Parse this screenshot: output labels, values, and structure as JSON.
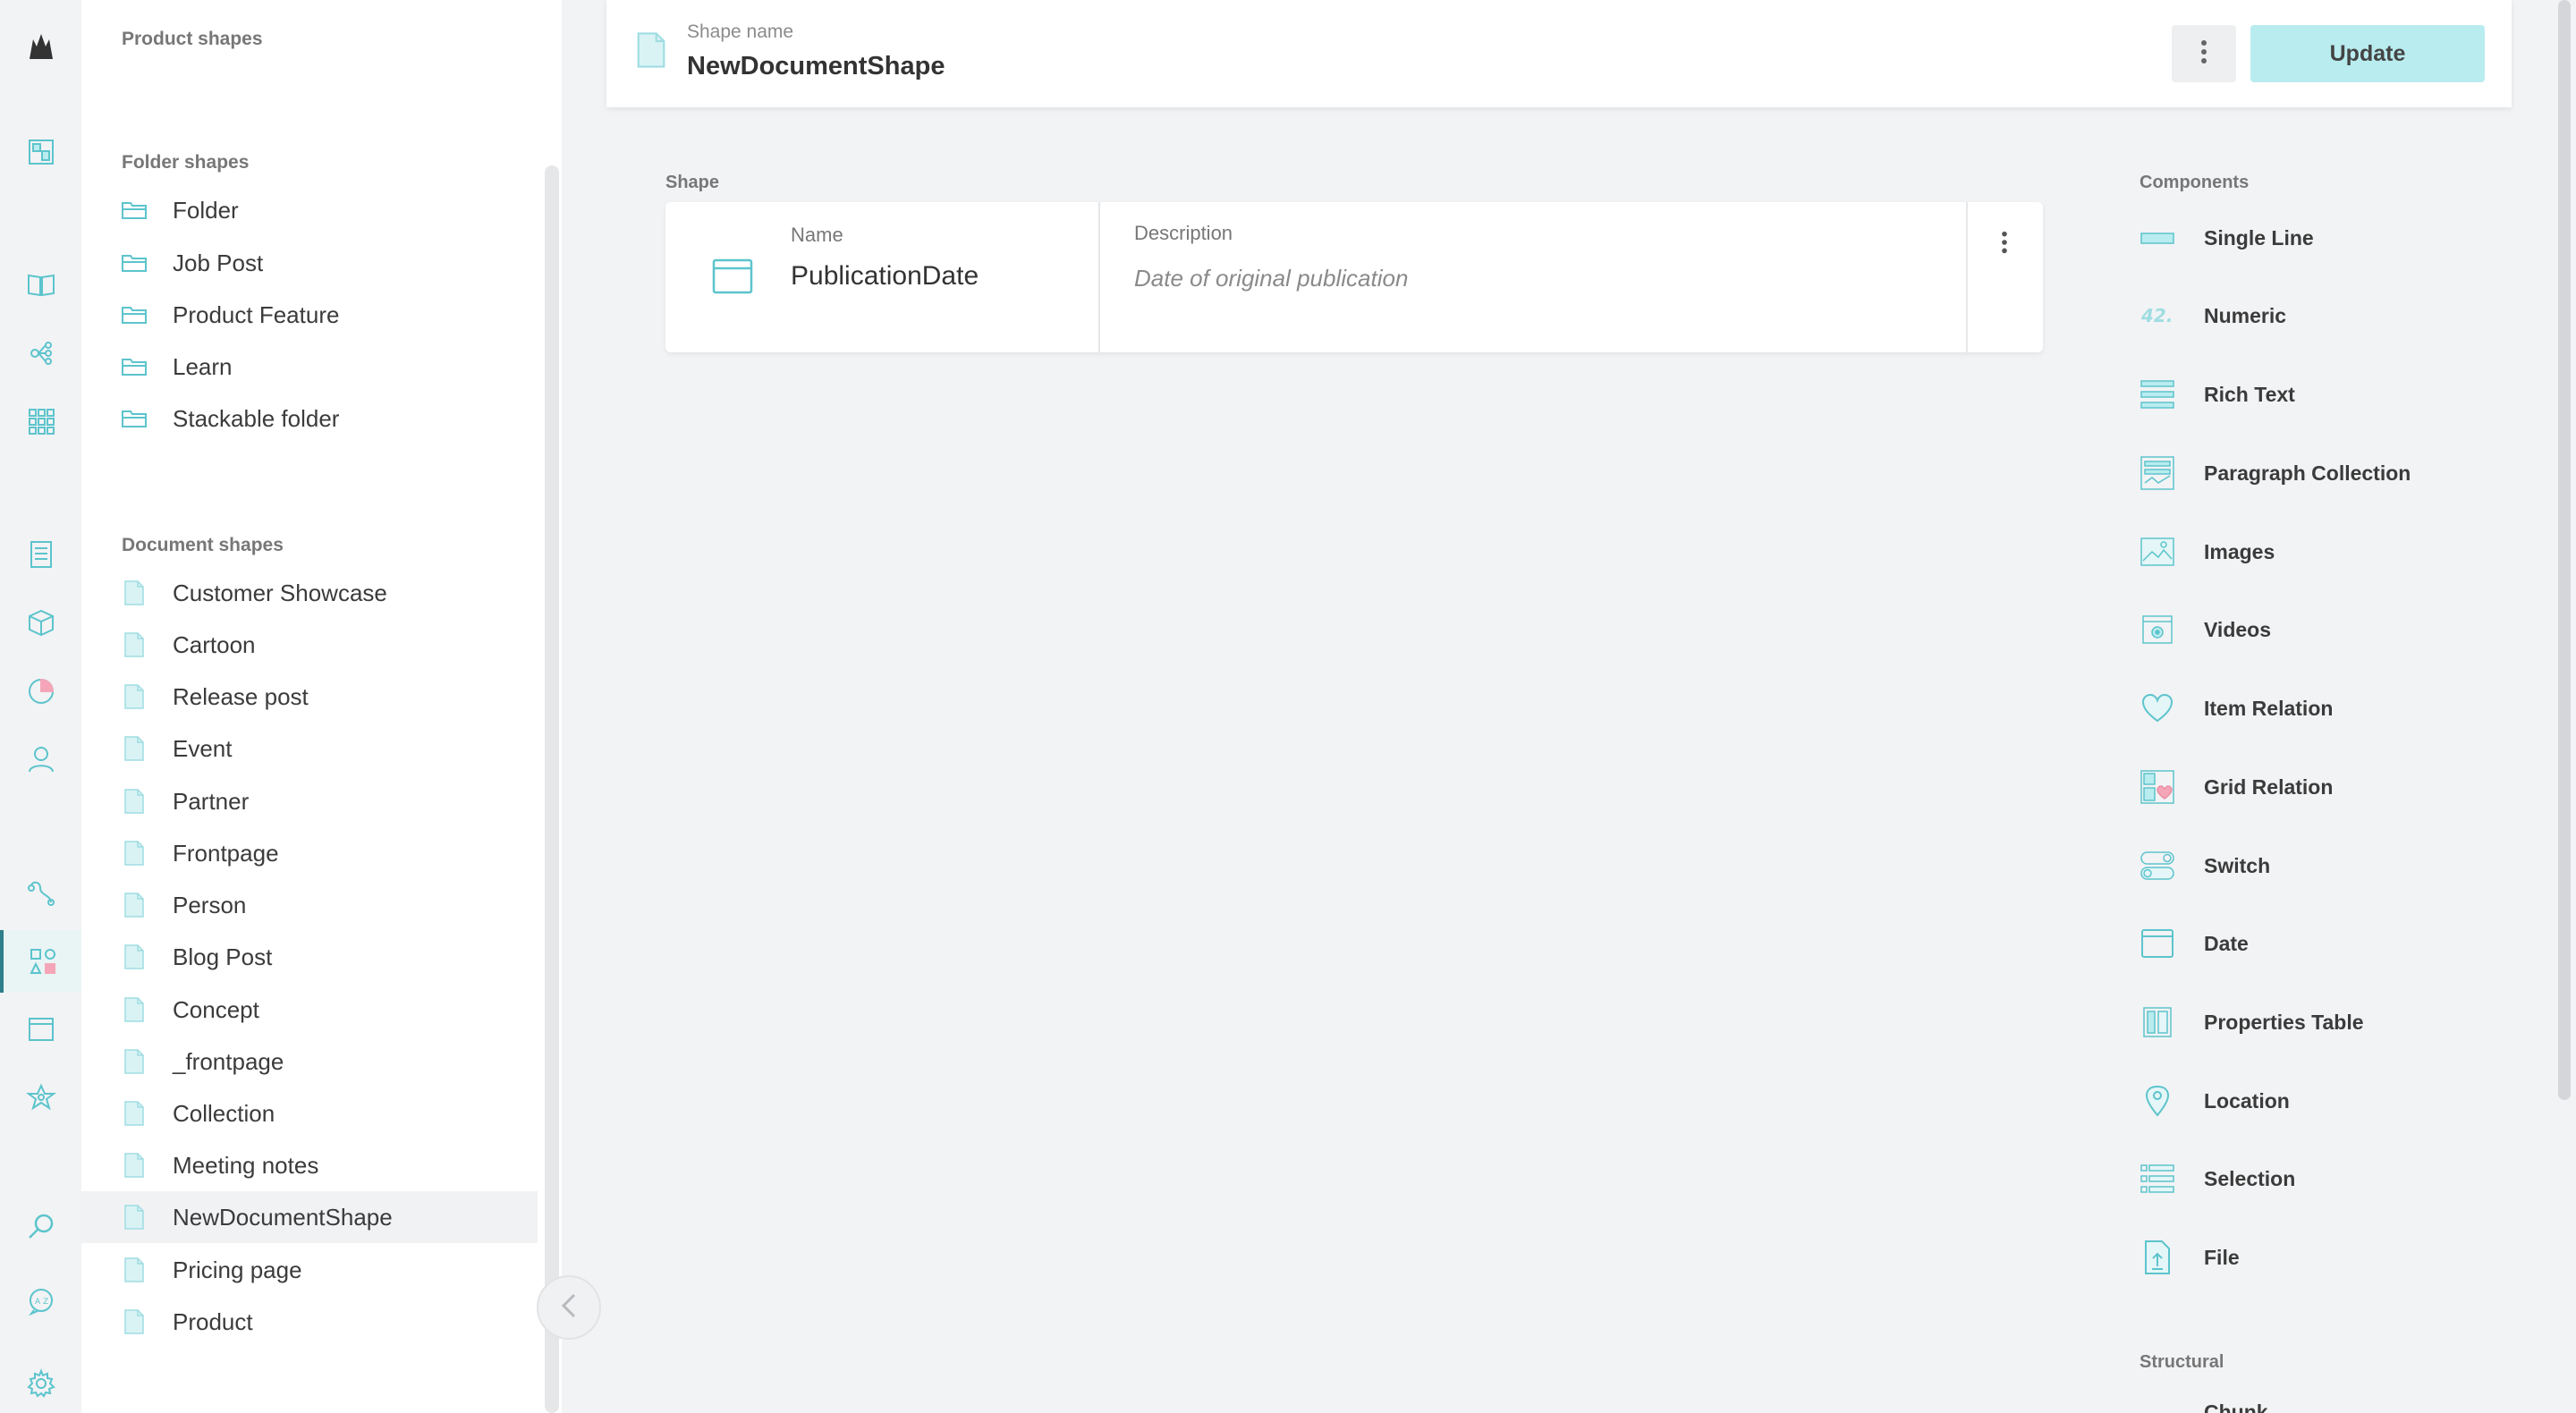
{
  "rail": {
    "items": [
      {
        "icon": "crystallize-logo-icon"
      },
      {
        "icon": "dashboard-icon"
      },
      {
        "icon": "catalogue-book-icon"
      },
      {
        "icon": "topics-graph-icon"
      },
      {
        "icon": "grids-icon"
      },
      {
        "icon": "orders-list-icon"
      },
      {
        "icon": "products-box-icon"
      },
      {
        "icon": "analytics-pie-icon"
      },
      {
        "icon": "customers-user-icon"
      },
      {
        "icon": "pipelines-icon"
      },
      {
        "icon": "shapes-icon"
      },
      {
        "icon": "pages-window-icon"
      },
      {
        "icon": "settings-star-icon"
      },
      {
        "icon": "search-icon"
      },
      {
        "icon": "language-chat-icon"
      },
      {
        "icon": "gear-icon"
      }
    ]
  },
  "sidebar": {
    "product_title": "Product shapes",
    "folder_title": "Folder shapes",
    "folder_items": [
      "Folder",
      "Job Post",
      "Product Feature",
      "Learn",
      "Stackable folder"
    ],
    "document_title": "Document shapes",
    "document_items": [
      "Customer Showcase",
      "Cartoon",
      "Release post",
      "Event",
      "Partner",
      "Frontpage",
      "Person",
      "Blog Post",
      "Concept",
      "_frontpage",
      "Collection",
      "Meeting notes",
      "NewDocumentShape",
      "Pricing page",
      "Product"
    ],
    "selected": "NewDocumentShape"
  },
  "header": {
    "shape_name_label": "Shape name",
    "shape_name_value": "NewDocumentShape",
    "update_label": "Update"
  },
  "editor": {
    "section_label": "Shape",
    "component": {
      "name_label": "Name",
      "name_value": "PublicationDate",
      "description_label": "Description",
      "description_value": "Date of original publication"
    }
  },
  "components": {
    "title": "Components",
    "items": [
      {
        "label": "Single Line",
        "icon": "single-line-icon"
      },
      {
        "label": "Numeric",
        "icon": "numeric-icon"
      },
      {
        "label": "Rich Text",
        "icon": "rich-text-icon"
      },
      {
        "label": "Paragraph Collection",
        "icon": "paragraph-collection-icon"
      },
      {
        "label": "Images",
        "icon": "images-icon"
      },
      {
        "label": "Videos",
        "icon": "videos-icon"
      },
      {
        "label": "Item Relation",
        "icon": "item-relation-heart-icon"
      },
      {
        "label": "Grid Relation",
        "icon": "grid-relation-icon"
      },
      {
        "label": "Switch",
        "icon": "switch-icon"
      },
      {
        "label": "Date",
        "icon": "date-icon"
      },
      {
        "label": "Properties Table",
        "icon": "properties-table-icon"
      },
      {
        "label": "Location",
        "icon": "location-pin-icon"
      },
      {
        "label": "Selection",
        "icon": "selection-list-icon"
      },
      {
        "label": "File",
        "icon": "file-upload-icon"
      }
    ],
    "structural_title": "Structural",
    "structural_peek": "Chunk"
  },
  "colors": {
    "accent": "#5cc4cc",
    "accent_light": "#b9ecef",
    "active_rail": "#2d7f89"
  }
}
